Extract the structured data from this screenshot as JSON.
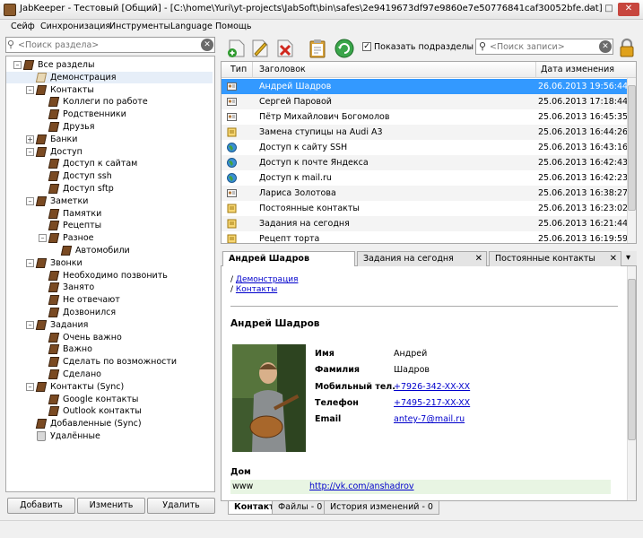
{
  "window": {
    "title": "JabKeeper - Тестовый [Общий] - [C:\\home\\Yuri\\yt-projects\\JabSoft\\bin\\safes\\2e9419673df97e9860e7e50776841caf30052bfe.dat]",
    "minimize": "–",
    "maximize": "□",
    "close": "✕"
  },
  "menu": [
    "Сейф",
    "Синхронизация",
    "Инструменты",
    "Language",
    "Помощь"
  ],
  "section_search": {
    "placeholder": "<Поиск раздела>",
    "icon": "search-icon",
    "clear": "✕"
  },
  "tree": [
    {
      "label": "Все разделы",
      "expander": "–"
    },
    {
      "label": "Демонстрация",
      "icon": "open"
    },
    {
      "label": "Контакты",
      "expander": "–"
    },
    {
      "label": "Коллеги по работе"
    },
    {
      "label": "Родственники"
    },
    {
      "label": "Друзья"
    },
    {
      "label": "Банки",
      "expander": "+"
    },
    {
      "label": "Доступ",
      "expander": "–"
    },
    {
      "label": "Доступ к сайтам"
    },
    {
      "label": "Доступ ssh"
    },
    {
      "label": "Доступ sftp"
    },
    {
      "label": "Заметки",
      "expander": "–"
    },
    {
      "label": "Памятки"
    },
    {
      "label": "Рецепты"
    },
    {
      "label": "Разное",
      "expander": "–"
    },
    {
      "label": "Автомобили"
    },
    {
      "label": "Звонки",
      "expander": "–"
    },
    {
      "label": "Необходимо позвонить"
    },
    {
      "label": "Занято"
    },
    {
      "label": "Не отвечают"
    },
    {
      "label": "Дозвонился"
    },
    {
      "label": "Задания",
      "expander": "–"
    },
    {
      "label": "Очень важно"
    },
    {
      "label": "Важно"
    },
    {
      "label": "Сделать по возможности"
    },
    {
      "label": "Сделано"
    },
    {
      "label": "Контакты (Sync)",
      "expander": "–"
    },
    {
      "label": "Google контакты"
    },
    {
      "label": "Outlook контакты"
    },
    {
      "label": "Добавленные (Sync)"
    },
    {
      "label": "Удалённые",
      "icon": "trash"
    }
  ],
  "left_buttons": {
    "add": "Добавить",
    "edit": "Изменить",
    "delete": "Удалить"
  },
  "toolbar": {
    "icons": [
      "add-record-icon",
      "edit-record-icon",
      "delete-record-icon",
      "clipboard-icon",
      "refresh-icon"
    ],
    "show_subsections_label": "Показать подразделы",
    "show_subsections_checked": "✓",
    "record_search_placeholder": "<Поиск записи>",
    "record_search_clear": "✕",
    "lock_icon": "lock-icon"
  },
  "records": {
    "columns": {
      "type": "Тип",
      "title": "Заголовок",
      "date": "Дата изменения"
    },
    "rows": [
      {
        "type": "contact-card-icon",
        "title": "Андрей  Шадров",
        "date": "26.06.2013 19:56:44",
        "selected": true
      },
      {
        "type": "contact-card-icon",
        "title": "Сергей  Паровой",
        "date": "25.06.2013 17:18:44"
      },
      {
        "type": "contact-card-icon",
        "title": "Пётр Михайлович Богомолов",
        "date": "25.06.2013 16:45:35"
      },
      {
        "type": "note-icon",
        "title": "Замена ступицы на Audi A3",
        "date": "25.06.2013 16:44:26"
      },
      {
        "type": "globe-icon",
        "title": "Доступ к сайту SSH",
        "date": "25.06.2013 16:43:16"
      },
      {
        "type": "globe-icon",
        "title": "Доступ к почте Яндекса",
        "date": "25.06.2013 16:42:43"
      },
      {
        "type": "globe-icon",
        "title": "Доступ к mail.ru",
        "date": "25.06.2013 16:42:23"
      },
      {
        "type": "contact-card-icon",
        "title": "Лариса  Золотова",
        "date": "25.06.2013 16:38:27"
      },
      {
        "type": "note-icon",
        "title": "Постоянные контакты",
        "date": "25.06.2013 16:23:02"
      },
      {
        "type": "note-icon",
        "title": "Задания на сегодня",
        "date": "25.06.2013 16:21:44"
      },
      {
        "type": "note-icon",
        "title": "Рецепт торта",
        "date": "25.06.2013 16:19:59"
      }
    ]
  },
  "detail_tabs": [
    {
      "label": "Андрей  Шадров",
      "active": true
    },
    {
      "label": "Задания на сегодня",
      "close": "✕"
    },
    {
      "label": "Постоянные контакты",
      "close": "✕"
    }
  ],
  "detail_tabs_menu": "▾",
  "detail": {
    "breadcrumb_prefix_1": "/ ",
    "breadcrumb_1": "Демонстрация",
    "breadcrumb_prefix_2": "/ ",
    "breadcrumb_2": "Контакты",
    "name": "Андрей Шадров",
    "fields": [
      {
        "label": "Имя",
        "value": "Андрей",
        "link": false
      },
      {
        "label": "Фамилия",
        "value": "Шадров",
        "link": false
      },
      {
        "label": "Мобильный тел.",
        "value": "+7926-342-XX-XX",
        "link": true
      },
      {
        "label": "Телефон",
        "value": "+7495-217-XX-XX",
        "link": true
      },
      {
        "label": "Email",
        "value": "antey-7@mail.ru",
        "link": true
      }
    ],
    "home_heading": "Дом",
    "home_row": {
      "label": "www",
      "value": "http://vk.com/anshadrov"
    }
  },
  "bottom_tabs": [
    {
      "label": "Контакт",
      "active": true
    },
    {
      "label": "Файлы - 0"
    },
    {
      "label": "История изменений - 0"
    }
  ],
  "colors": {
    "selection": "#3399ff",
    "link": "#0000cc",
    "folder": "#7a4a22"
  }
}
